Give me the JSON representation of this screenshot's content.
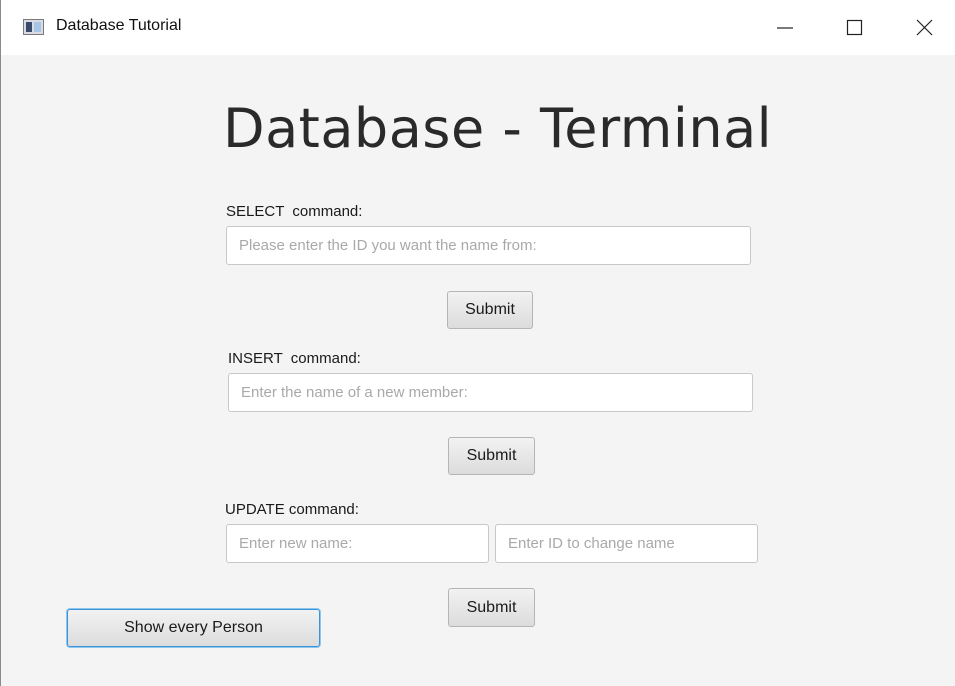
{
  "window": {
    "title": "Database Tutorial",
    "controls": {
      "minimize_icon": "minimize-icon",
      "maximize_icon": "maximize-icon",
      "close_icon": "close-icon"
    }
  },
  "main": {
    "title": "Database - Terminal",
    "select": {
      "label": "SELECT  command:",
      "placeholder": "Please enter the ID you want the name from:",
      "value": "",
      "submit_label": "Submit"
    },
    "insert": {
      "label": "INSERT  command:",
      "placeholder": "Enter the name of a new member:",
      "value": "",
      "submit_label": "Submit"
    },
    "update": {
      "label": "UPDATE command:",
      "name_placeholder": "Enter new name:",
      "name_value": "",
      "id_placeholder": "Enter ID to change name",
      "id_value": "",
      "submit_label": "Submit"
    },
    "show_all_label": "Show every Person"
  },
  "colors": {
    "background": "#f4f4f4",
    "focus_ring": "#3a95d8"
  }
}
